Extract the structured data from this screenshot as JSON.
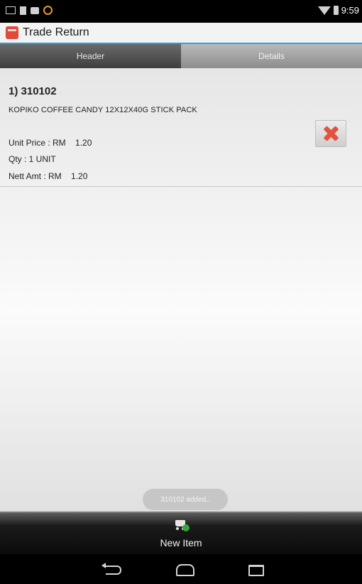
{
  "status_bar": {
    "time": "9:59",
    "icons": [
      "screenshot-icon",
      "document-icon",
      "photo-icon",
      "coin-icon",
      "wifi-icon",
      "battery-icon"
    ]
  },
  "app": {
    "title": "Trade Return",
    "accent_color": "#2ba2d4",
    "icon": "app-icon"
  },
  "tabs": [
    {
      "label": "Header",
      "active": true
    },
    {
      "label": "Details",
      "active": false
    }
  ],
  "item": {
    "title": "1) 310102",
    "description": "KOPIKO COFFEE CANDY 12X12X40G STICK PACK",
    "unit_price": "Unit Price : RM    1.20",
    "qty": "Qty : 1 UNIT",
    "nett_amt": "Nett Amt : RM    1.20",
    "delete_icon": "delete-x-icon",
    "delete_color": "#e2523f"
  },
  "toast": {
    "text": "310102 added.."
  },
  "action_bar": {
    "new_item_label": "New Item",
    "icon": "add-cart-icon"
  },
  "nav_bar": {
    "icons": [
      "back-icon",
      "home-icon",
      "recents-icon"
    ]
  }
}
